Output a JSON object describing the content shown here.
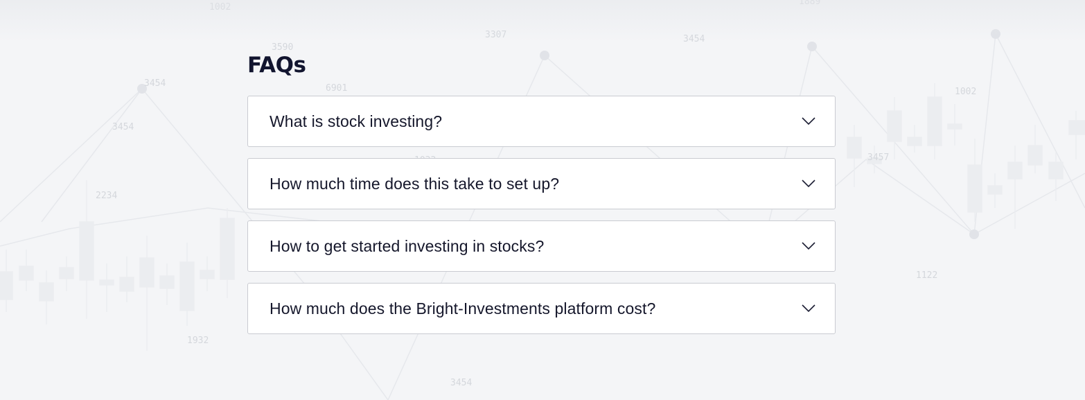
{
  "faq": {
    "title": "FAQs",
    "items": [
      {
        "question": "What is stock investing?",
        "icon": "chevron-down-icon"
      },
      {
        "question": "How much time does this take to set up?",
        "icon": "chevron-down-icon"
      },
      {
        "question": "How to get started investing in stocks?",
        "icon": "chevron-down-icon"
      },
      {
        "question": "How much does the Bright-Investments platform cost?",
        "icon": "chevron-down-icon"
      }
    ]
  },
  "background": {
    "numbers": [
      "1002",
      "3307",
      "3454",
      "1889",
      "3590",
      "3454",
      "6901",
      "3454",
      "1002",
      "1032",
      "2234",
      "3457",
      "1932",
      "3454",
      "3454",
      "1122"
    ]
  },
  "colors": {
    "background": "#f4f5f7",
    "card": "#ffffff",
    "card_border": "#c9cbd1",
    "text": "#15172b",
    "decoration": "#e3e5e9"
  }
}
